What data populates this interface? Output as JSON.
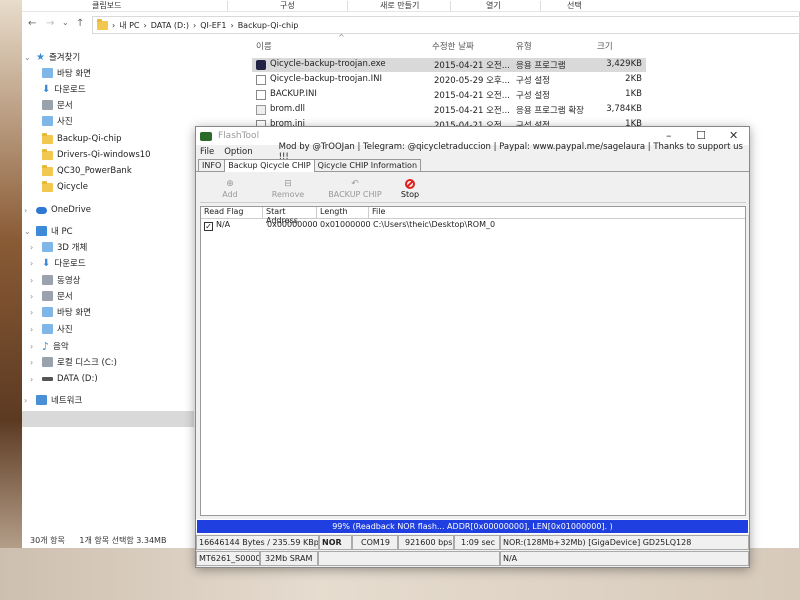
{
  "ribbon": {
    "clipboard": "클립보드",
    "organize": "구성",
    "new": "새로 만들기",
    "open": "열기",
    "select": "선택"
  },
  "address": {
    "parts": [
      "내 PC",
      "DATA (D:)",
      "QI-EF1",
      "Backup-Qi-chip"
    ]
  },
  "nav": {
    "quick_access": "즐겨찾기",
    "items": [
      "바탕 화면",
      "다운로드",
      "문서",
      "사진",
      "Backup-Qi-chip",
      "Drivers-Qi-windows10",
      "QC30_PowerBank",
      "Qicycle"
    ],
    "onedrive": "OneDrive",
    "this_pc": "내 PC",
    "pc_items": [
      "3D 개체",
      "다운로드",
      "동영상",
      "문서",
      "바탕 화면",
      "사진",
      "음악",
      "로컬 디스크 (C:)",
      "DATA (D:)"
    ],
    "network": "네트워크"
  },
  "status": {
    "count": "30개 항목",
    "selected": "1개 항목 선택함 3.34MB"
  },
  "columns": {
    "name": "이름",
    "date": "수정한 날짜",
    "type": "유형",
    "size": "크기"
  },
  "files": [
    {
      "name": "Qicycle-backup-troojan.exe",
      "date": "2015-04-21 오전...",
      "type": "응용 프로그램",
      "size": "3,429KB"
    },
    {
      "name": "Qicycle-backup-troojan.INI",
      "date": "2020-05-29 오후...",
      "type": "구성 설정",
      "size": "2KB"
    },
    {
      "name": "BACKUP.INI",
      "date": "2015-04-21 오전...",
      "type": "구성 설정",
      "size": "1KB"
    },
    {
      "name": "brom.dll",
      "date": "2015-04-21 오전...",
      "type": "응용 프로그램 확장",
      "size": "3,784KB"
    },
    {
      "name": "brom.ini",
      "date": "2015-04-21 오전...",
      "type": "구성 설정",
      "size": "1KB"
    }
  ],
  "flashtool": {
    "title": "FlashTool",
    "menu": [
      "File",
      "Option",
      "Mod by @TrOOJan | Telegram: @qicycletraduccion | Paypal: www.paypal.me/sagelaura | Thanks to support us !!!"
    ],
    "tabs": [
      "INFO",
      "Backup Qicycle CHIP",
      "Qicycle CHIP Information"
    ],
    "toolbar": {
      "add": "Add",
      "remove": "Remove",
      "backup": "BACKUP CHIP",
      "stop": "Stop"
    },
    "list_headers": [
      "Read Flag",
      "Start Address",
      "Length",
      "File"
    ],
    "row": {
      "flag": "N/A",
      "start": "0x00000000",
      "length": "0x01000000",
      "file": "C:\\Users\\theic\\Desktop\\ROM_0"
    },
    "progress": "99% (Readback NOR flash... ADDR[0x00000000], LEN[0x01000000].  )",
    "status1": [
      "16646144 Bytes / 235.59 KBps",
      "NOR",
      "COM19",
      "921600 bps",
      "1:09 sec",
      "NOR:(128Mb+32Mb) [GigaDevice] GD25LQ128"
    ],
    "status2": [
      "MT6261_S0000",
      "32Mb SRAM",
      "N/A"
    ]
  }
}
